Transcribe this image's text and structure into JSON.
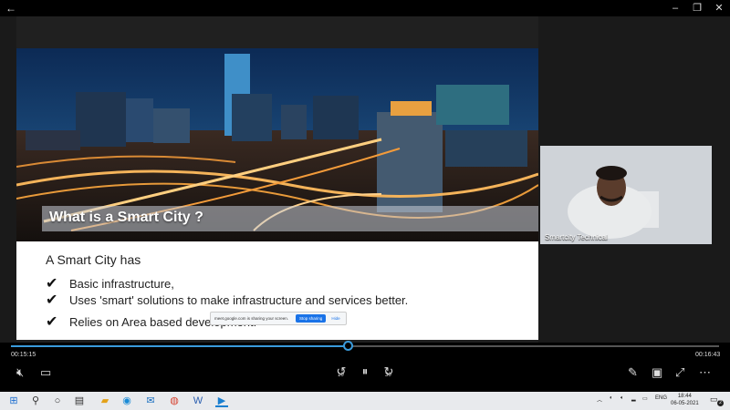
{
  "window": {
    "back_glyph": "←",
    "minimize_glyph": "–",
    "restore_glyph": "❐",
    "close_glyph": "✕"
  },
  "slide": {
    "title": "What is a Smart City ?",
    "intro": "A Smart City has",
    "bullets": [
      "Basic infrastructure,",
      "Uses 'smart' solutions to make infrastructure and services better.",
      "Relies on Area based development."
    ],
    "check_glyph": "✔"
  },
  "share_bar": {
    "message": "meet.google.com is sharing your screen.",
    "stop_label": "Stop sharing",
    "hide_label": "Hide"
  },
  "camera": {
    "participant_name": "Smartcity Technical"
  },
  "player": {
    "current_time": "00:15:15",
    "total_time": "00:16:43",
    "progress": 0.476,
    "skip_back_label": "10",
    "skip_forward_label": "30",
    "accent": "#3a9bdc"
  },
  "taskbar": {
    "time": "18:44",
    "date": "06-05-2021",
    "language": "ENG",
    "notification_count": "2"
  }
}
